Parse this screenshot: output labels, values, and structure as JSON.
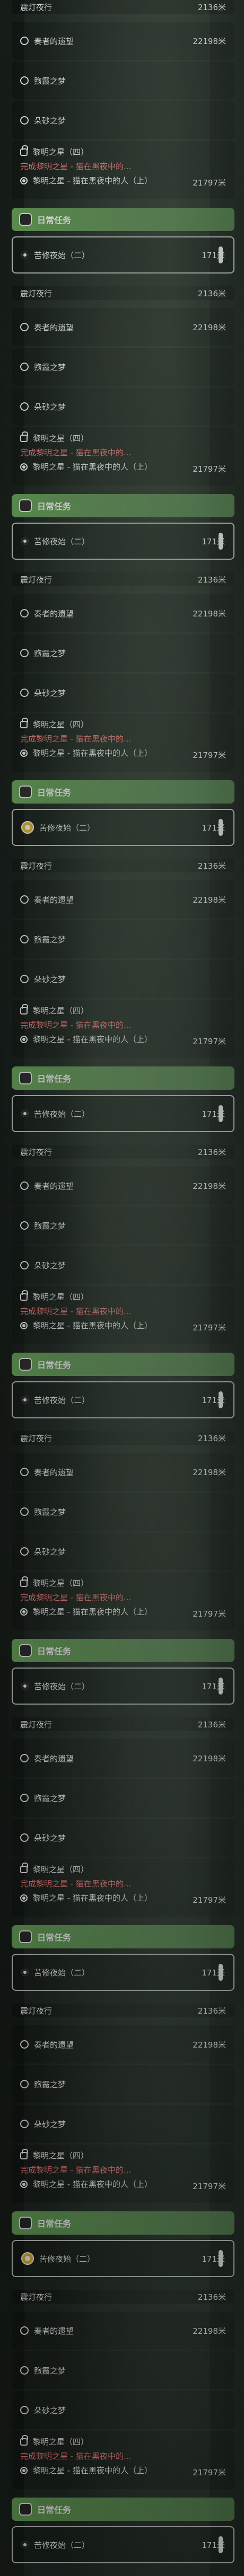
{
  "rows": [
    {
      "title": "震灯夜行",
      "distance": "2136米"
    },
    {
      "title": "奏者的遗望",
      "distance": "22198米"
    },
    {
      "title": "煦霞之梦"
    },
    {
      "title": "朵砂之梦"
    },
    {
      "title": "黎明之星（四）",
      "subtitle": "完成黎明之星 - 猫在黑夜中的...",
      "title2": "黎明之星 - 猫在黑夜中的人（上）",
      "distance": "21797米"
    },
    {
      "title": "日常任务"
    },
    {
      "title": "苦修夜始（二）",
      "distance": "171米"
    }
  ],
  "panels": [
    {
      "style": "default"
    },
    {
      "style": "default"
    },
    {
      "style": "selected"
    },
    {
      "style": "default"
    },
    {
      "style": "default"
    },
    {
      "style": "default"
    },
    {
      "style": "default"
    },
    {
      "style": "selected"
    },
    {
      "style": "default"
    }
  ],
  "icons": {
    "circle": "circle-icon",
    "lock": "lock-icon",
    "pin": "pin-icon",
    "badge": "badge-icon",
    "scroll": "scroll-handle",
    "selected": "selected-task-icon"
  }
}
